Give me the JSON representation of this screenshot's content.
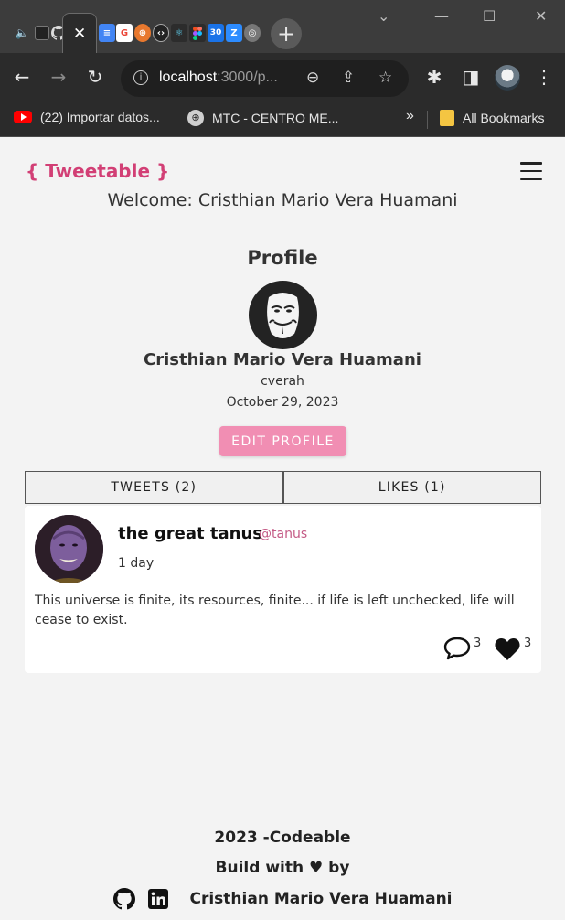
{
  "browser": {
    "url_host": "localhost",
    "url_rest": ":3000/p...",
    "bookmarks": [
      {
        "label": "(22) Importar datos..."
      },
      {
        "label": "MTC - CENTRO ME..."
      }
    ],
    "bookmarks_overflow": "»",
    "all_bookmarks": "All Bookmarks",
    "pinned_tabs": [
      "google-docs",
      "google",
      "basketball",
      "devtools",
      "react",
      "figma",
      "calendar-30",
      "zoom",
      "chrome"
    ]
  },
  "app": {
    "brand": "{ Tweetable }",
    "welcome": "Welcome: Cristhian Mario Vera Huamani"
  },
  "profile": {
    "heading": "Profile",
    "name": "Cristhian Mario Vera Huamani",
    "username": "cverah",
    "joined": "October 29, 2023",
    "edit_label": "EDIT PROFILE"
  },
  "tabs": {
    "tweets_label": "TWEETS (2)",
    "likes_label": "LIKES (1)"
  },
  "tweet": {
    "name": "the great tanus",
    "handle": "@tanus",
    "time": "1 day",
    "text": "This universe is finite, its resources, finite... if life is left unchecked, life will cease to exist.",
    "replies": "3",
    "likes": "3"
  },
  "footer": {
    "year": "2023 -Codeable",
    "built": "Build with ♥ by",
    "author": "Cristhian Mario Vera Huamani"
  }
}
